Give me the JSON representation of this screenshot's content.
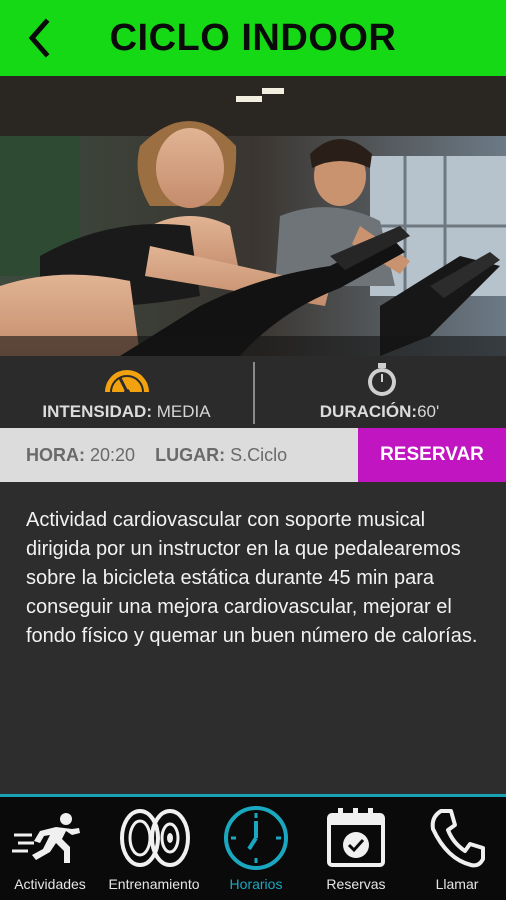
{
  "header": {
    "title": "CICLO INDOOR"
  },
  "hero": {
    "description": "Indoor cycling class photo: woman and man on spinning bikes"
  },
  "stats": {
    "intensity_label": "INTENSIDAD:",
    "intensity_value": "MEDIA",
    "duration_label": "DURACIÓN:",
    "duration_value": "60'"
  },
  "info": {
    "hour_label": "HORA:",
    "hour_value": "20:20",
    "place_label": "LUGAR:",
    "place_value": "S.Ciclo",
    "reserve_label": "RESERVAR"
  },
  "description": "Actividad cardiovascular con soporte musical dirigida por un instructor en la que pedalearemos sobre la bicicleta estática durante 45 min para conseguir una mejora cardiovascular, mejorar el fondo físico y quemar un buen número de calorías.",
  "nav": {
    "items": [
      {
        "label": "Actividades",
        "icon": "runner-icon"
      },
      {
        "label": "Entrenamiento",
        "icon": "weight-plates-icon"
      },
      {
        "label": "Horarios",
        "icon": "clock-icon",
        "active": true
      },
      {
        "label": "Reservas",
        "icon": "calendar-check-icon"
      },
      {
        "label": "Llamar",
        "icon": "phone-icon"
      }
    ]
  },
  "colors": {
    "header_green": "#16d916",
    "reserve_magenta": "#c115c1",
    "active_cyan": "#1aa8c0",
    "gauge_orange": "#f2a20f"
  }
}
